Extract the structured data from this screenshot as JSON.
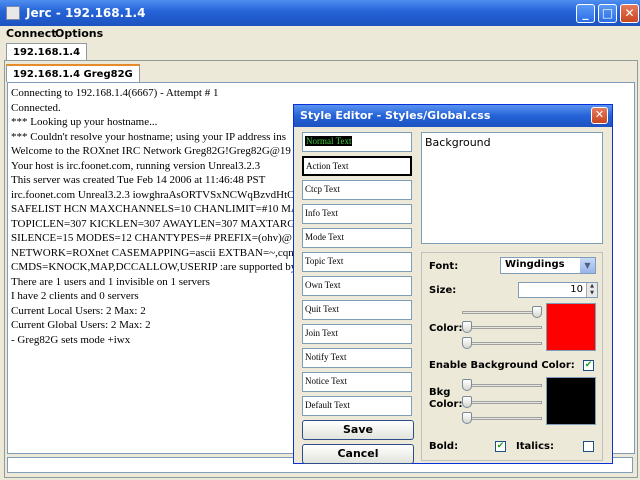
{
  "window": {
    "title": "Jerc - 192.168.1.4"
  },
  "menu": {
    "connect": "Connect",
    "options": "Options"
  },
  "tabs": {
    "server_tab": "192.168.1.4",
    "channel_tab": "192.168.1.4 Greg82G"
  },
  "chat_lines": [
    "Connecting to 192.168.1.4(6667) - Attempt # 1",
    "Connected.",
    "*** Looking up your hostname...",
    "*** Couldn't resolve your hostname; using your IP address ins",
    "Welcome to the ROXnet IRC Network Greg82G!Greg82G@19",
    "Your host is irc.foonet.com, running version Unreal3.2.3",
    "This server was created Tue Feb 14 2006 at 11:46:48 PST",
    "irc.foonet.com Unreal3.2.3 iowghraAsORTVSxNCWqBzvdHtO",
    "SAFELIST HCN MAXCHANNELS=10 CHANLIMIT=#10 MA",
    "TOPICLEN=307 KICKLEN=307 AWAYLEN=307 MAXTARG",
    "SILENCE=15 MODES=12 CHANTYPES=# PREFIX=(ohv)@",
    "NETWORK=ROXnet CASEMAPPING=ascii EXTBAN=~,cqnr",
    "CMDS=KNOCK,MAP,DCCALLOW,USERIP :are supported by",
    "There are 1 users and 1 invisible on 1 servers",
    "I have 2 clients and 0 servers",
    "Current Local Users: 2 Max: 2",
    "Current Global Users: 2 Max: 2",
    "- Greg82G sets mode +iwx"
  ],
  "style_editor": {
    "title": "Style Editor - Styles/Global.css",
    "styles": [
      "Normal Text",
      "Action Text",
      "Ctcp Text",
      "Info Text",
      "Mode Text",
      "Topic Text",
      "Own Text",
      "Quit Text",
      "Join Text",
      "Notify Text",
      "Notice Text",
      "Default Text"
    ],
    "save_label": "Save",
    "cancel_label": "Cancel",
    "preview_text": "Background",
    "font_label": "Font:",
    "font_value": "Wingdings",
    "size_label": "Size:",
    "size_value": "10",
    "color_label": "Color:",
    "color_value": "#ff0000",
    "enable_bg_label": "Enable Background Color:",
    "enable_bg_checked": true,
    "bkg_label_1": "Bkg",
    "bkg_label_2": "Color:",
    "bkg_color_value": "#000000",
    "bold_label": "Bold:",
    "bold_checked": true,
    "italics_label": "Italics:",
    "italics_checked": false,
    "color_rgb_levels": [
      1.0,
      0.0,
      0.0
    ],
    "bkg_rgb_levels": [
      0.0,
      0.0,
      0.0
    ]
  }
}
